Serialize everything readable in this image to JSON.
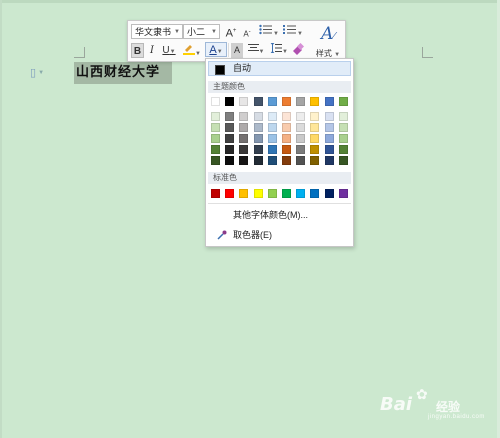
{
  "document": {
    "selected_text": "山西财经大学"
  },
  "toolbar": {
    "font_name": "华文隶书",
    "font_size": "小二",
    "grow_font": "A",
    "shrink_font": "A",
    "bold": "B",
    "italic": "I",
    "underline": "U",
    "font_color": "A",
    "char_shading": "A",
    "styles_label": "样式"
  },
  "color_menu": {
    "auto_label": "自动",
    "theme_header": "主题颜色",
    "theme_colors": [
      "#ffffff",
      "#000000",
      "#e7e6e6",
      "#44546a",
      "#5b9bd5",
      "#ed7d31",
      "#a5a5a5",
      "#ffc000",
      "#4472c4",
      "#70ad47"
    ],
    "theme_shade_columns": [
      [
        "#e2efda",
        "#c6e0b4",
        "#a9d08e",
        "#548235",
        "#375623"
      ],
      [
        "#7f7f7f",
        "#595959",
        "#404040",
        "#262626",
        "#0d0d0d"
      ],
      [
        "#d0cece",
        "#aeaaaa",
        "#757171",
        "#3a3838",
        "#171616"
      ],
      [
        "#d6dce4",
        "#acb9ca",
        "#8497b0",
        "#333f4f",
        "#222b35"
      ],
      [
        "#ddebf7",
        "#bdd7ee",
        "#9bc2e6",
        "#2f75b5",
        "#1f4e78"
      ],
      [
        "#fce4d6",
        "#f8cbad",
        "#f4b084",
        "#c65911",
        "#833c0c"
      ],
      [
        "#ededed",
        "#dbdbdb",
        "#c9c9c9",
        "#7b7b7b",
        "#525252"
      ],
      [
        "#fff2cc",
        "#ffe699",
        "#ffd966",
        "#bf8f00",
        "#806000"
      ],
      [
        "#d9e1f2",
        "#b4c6e7",
        "#8ea9db",
        "#305496",
        "#203764"
      ],
      [
        "#e2efda",
        "#c6e0b4",
        "#a9d08e",
        "#548235",
        "#375623"
      ]
    ],
    "standard_header": "标准色",
    "standard_colors": [
      "#c00000",
      "#ff0000",
      "#ffc000",
      "#ffff00",
      "#92d050",
      "#00b050",
      "#00b0f0",
      "#0070c0",
      "#002060",
      "#7030a0"
    ],
    "more_colors_label": "其他字体颜色(M)...",
    "eyedropper_label": "取色器(E)"
  },
  "watermark": {
    "brand": "Bai",
    "brand2": "经验",
    "sub": "jingyan.baidu.com"
  }
}
